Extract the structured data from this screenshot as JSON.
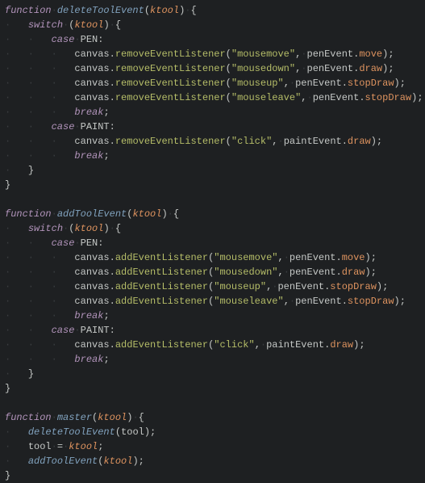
{
  "kw": {
    "function": "function",
    "switch": "switch",
    "case": "case",
    "break": "break"
  },
  "fn": {
    "deleteToolEvent": "deleteToolEvent",
    "addToolEvent": "addToolEvent",
    "master": "master"
  },
  "param": {
    "ktool": "ktool"
  },
  "const": {
    "PEN": "PEN",
    "PAINT": "PAINT"
  },
  "ident": {
    "canvas": "canvas",
    "penEvent": "penEvent",
    "paintEvent": "paintEvent",
    "tool": "tool"
  },
  "method": {
    "removeEventListener": "removeEventListener",
    "addEventListener": "addEventListener"
  },
  "prop": {
    "move": "move",
    "draw": "draw",
    "stopDraw": "stopDraw"
  },
  "str": {
    "mousemove": "\"mousemove\"",
    "mousedown": "\"mousedown\"",
    "mouseup": "\"mouseup\"",
    "mouseleave": "\"mouseleave\"",
    "click": "\"click\""
  }
}
